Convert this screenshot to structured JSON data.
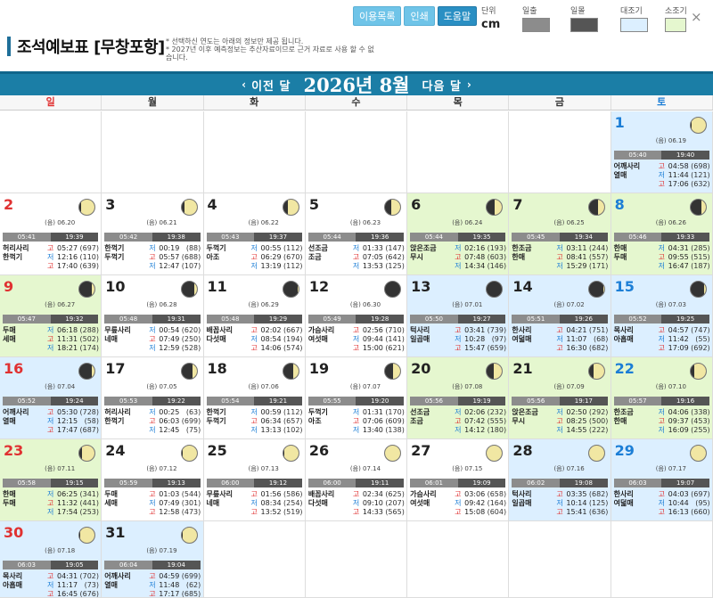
{
  "page": {
    "title": "조석예보표 [무창포항]",
    "notes": [
      "* 선택하신 연도는 아래의 정보만 제공 됩니다.",
      "* 2027년 이후 예측정보는 추산자료이므로 근거 자료로 사용 할 수 없습니다."
    ]
  },
  "toolbar": {
    "buttons": [
      "이용목록",
      "인쇄",
      "도움말"
    ],
    "unit_label": "단위",
    "unit_value": "cm",
    "legend": [
      {
        "label": "일출",
        "color": "#8c8c8c"
      },
      {
        "label": "일몰",
        "color": "#555555"
      },
      {
        "label": "대조기",
        "color": "#dcefff"
      },
      {
        "label": "소조기",
        "color": "#e5f7cf"
      }
    ],
    "close": "×"
  },
  "nav": {
    "prev": "이전 달",
    "next": "다음 달",
    "month": "2026년 8월"
  },
  "weekdays": [
    "일",
    "월",
    "화",
    "수",
    "목",
    "금",
    "토"
  ],
  "colors": {
    "sunday": "#e03131",
    "saturday": "#1c7ed6",
    "header_bar": "#1b7ea6",
    "spring_tide": "#dcefff",
    "neap_tide": "#e5f7cf"
  },
  "days": [
    {
      "d": "1",
      "lunar": "(음) 06.19",
      "sr": "05:40",
      "ss": "19:40",
      "bg": "b",
      "moon": 0.93,
      "mn": [
        "어깨사리",
        "열매"
      ],
      "t": [
        [
          "고",
          "04:58",
          "(698)"
        ],
        [
          "저",
          "11:44",
          "(121)"
        ],
        [
          "고",
          "17:06",
          "(632)"
        ]
      ]
    },
    {
      "d": "2",
      "lunar": "(음) 06.20",
      "sr": "05:41",
      "ss": "19:39",
      "bg": "w",
      "moon": 0.87,
      "mn": [
        "허리사리",
        "한꺽기"
      ],
      "t": [
        [
          "고",
          "05:27",
          "(697)"
        ],
        [
          "저",
          "12:16",
          "(110)"
        ],
        [
          "고",
          "17:40",
          "(639)"
        ]
      ]
    },
    {
      "d": "3",
      "lunar": "(음) 06.21",
      "sr": "05:42",
      "ss": "19:38",
      "bg": "w",
      "moon": 0.8,
      "mn": [
        "한꺽기",
        "두꺽기"
      ],
      "t": [
        [
          "저",
          "00:19",
          "(88)"
        ],
        [
          "고",
          "05:57",
          "(688)"
        ],
        [
          "저",
          "12:47",
          "(107)"
        ]
      ]
    },
    {
      "d": "4",
      "lunar": "(음) 06.22",
      "sr": "05:43",
      "ss": "19:37",
      "bg": "w",
      "moon": 0.7,
      "mn": [
        "두꺽기",
        "아조"
      ],
      "t": [
        [
          "저",
          "00:55",
          "(112)"
        ],
        [
          "고",
          "06:29",
          "(670)"
        ],
        [
          "저",
          "13:19",
          "(112)"
        ]
      ]
    },
    {
      "d": "5",
      "lunar": "(음) 06.23",
      "sr": "05:44",
      "ss": "19:36",
      "bg": "w",
      "moon": 0.6,
      "mn": [
        "선조금",
        "조금"
      ],
      "t": [
        [
          "저",
          "01:33",
          "(147)"
        ],
        [
          "고",
          "07:05",
          "(642)"
        ],
        [
          "저",
          "13:53",
          "(125)"
        ]
      ]
    },
    {
      "d": "6",
      "lunar": "(음) 06.24",
      "sr": "05:44",
      "ss": "19:35",
      "bg": "g",
      "moon": 0.5,
      "mn": [
        "앉은조금",
        "무시"
      ],
      "t": [
        [
          "저",
          "02:16",
          "(193)"
        ],
        [
          "고",
          "07:48",
          "(603)"
        ],
        [
          "저",
          "14:34",
          "(146)"
        ]
      ]
    },
    {
      "d": "7",
      "lunar": "(음) 06.25",
      "sr": "05:45",
      "ss": "19:34",
      "bg": "g",
      "moon": 0.4,
      "mn": [
        "한조금",
        "한매"
      ],
      "t": [
        [
          "저",
          "03:11",
          "(244)"
        ],
        [
          "고",
          "08:41",
          "(557)"
        ],
        [
          "저",
          "15:29",
          "(171)"
        ]
      ]
    },
    {
      "d": "8",
      "lunar": "(음) 06.26",
      "sr": "05:46",
      "ss": "19:33",
      "bg": "g",
      "moon": 0.3,
      "mn": [
        "한매",
        "두매"
      ],
      "t": [
        [
          "저",
          "04:31",
          "(285)"
        ],
        [
          "고",
          "09:55",
          "(515)"
        ],
        [
          "저",
          "16:47",
          "(187)"
        ]
      ]
    },
    {
      "d": "9",
      "lunar": "(음) 06.27",
      "sr": "05:47",
      "ss": "19:32",
      "bg": "g",
      "moon": 0.2,
      "mn": [
        "두매",
        "세매"
      ],
      "t": [
        [
          "저",
          "06:18",
          "(288)"
        ],
        [
          "고",
          "11:31",
          "(502)"
        ],
        [
          "저",
          "18:21",
          "(174)"
        ]
      ]
    },
    {
      "d": "10",
      "lunar": "(음) 06.28",
      "sr": "05:48",
      "ss": "19:31",
      "bg": "w",
      "moon": 0.12,
      "mn": [
        "무릎사리",
        "네매"
      ],
      "t": [
        [
          "저",
          "00:54",
          "(620)"
        ],
        [
          "고",
          "07:49",
          "(250)"
        ],
        [
          "저",
          "12:59",
          "(528)"
        ]
      ]
    },
    {
      "d": "11",
      "lunar": "(음) 06.29",
      "sr": "05:48",
      "ss": "19:29",
      "bg": "w",
      "moon": 0.05,
      "mn": [
        "배꼽사리",
        "다섯매"
      ],
      "t": [
        [
          "고",
          "02:02",
          "(667)"
        ],
        [
          "저",
          "08:54",
          "(194)"
        ],
        [
          "고",
          "14:06",
          "(574)"
        ]
      ]
    },
    {
      "d": "12",
      "lunar": "(음) 06.30",
      "sr": "05:49",
      "ss": "19:28",
      "bg": "w",
      "moon": 0.0,
      "mn": [
        "가슴사리",
        "여섯매"
      ],
      "t": [
        [
          "고",
          "02:56",
          "(710)"
        ],
        [
          "저",
          "09:44",
          "(141)"
        ],
        [
          "고",
          "15:00",
          "(621)"
        ]
      ]
    },
    {
      "d": "13",
      "lunar": "(음) 07.01",
      "sr": "05:50",
      "ss": "19:27",
      "bg": "b",
      "moon": 0.0,
      "mn": [
        "턱사리",
        "일곱매"
      ],
      "t": [
        [
          "고",
          "03:41",
          "(739)"
        ],
        [
          "저",
          "10:28",
          "(97)"
        ],
        [
          "고",
          "15:47",
          "(659)"
        ]
      ]
    },
    {
      "d": "14",
      "lunar": "(음) 07.02",
      "sr": "05:51",
      "ss": "19:26",
      "bg": "b",
      "moon": 0.05,
      "mn": [
        "한사리",
        "여덟매"
      ],
      "t": [
        [
          "고",
          "04:21",
          "(751)"
        ],
        [
          "저",
          "11:07",
          "(68)"
        ],
        [
          "고",
          "16:30",
          "(682)"
        ]
      ]
    },
    {
      "d": "15",
      "lunar": "(음) 07.03",
      "sr": "05:52",
      "ss": "19:25",
      "bg": "b",
      "moon": 0.1,
      "mn": [
        "목사리",
        "아홉매"
      ],
      "t": [
        [
          "고",
          "04:57",
          "(747)"
        ],
        [
          "저",
          "11:42",
          "(55)"
        ],
        [
          "고",
          "17:09",
          "(692)"
        ]
      ]
    },
    {
      "d": "16",
      "lunar": "(음) 07.04",
      "sr": "05:52",
      "ss": "19:24",
      "bg": "b",
      "moon": 0.18,
      "mn": [
        "어깨사리",
        "열매"
      ],
      "t": [
        [
          "고",
          "05:30",
          "(728)"
        ],
        [
          "저",
          "12:15",
          "(58)"
        ],
        [
          "고",
          "17:47",
          "(687)"
        ]
      ]
    },
    {
      "d": "17",
      "lunar": "(음) 07.05",
      "sr": "05:53",
      "ss": "19:22",
      "bg": "w",
      "moon": 0.27,
      "mn": [
        "허리사리",
        "한꺽기"
      ],
      "t": [
        [
          "저",
          "00:25",
          "(63)"
        ],
        [
          "고",
          "06:03",
          "(699)"
        ],
        [
          "저",
          "12:45",
          "(75)"
        ]
      ]
    },
    {
      "d": "18",
      "lunar": "(음) 07.06",
      "sr": "05:54",
      "ss": "19:21",
      "bg": "w",
      "moon": 0.37,
      "mn": [
        "한꺽기",
        "두꺽기"
      ],
      "t": [
        [
          "저",
          "00:59",
          "(112)"
        ],
        [
          "고",
          "06:34",
          "(657)"
        ],
        [
          "저",
          "13:13",
          "(102)"
        ]
      ]
    },
    {
      "d": "19",
      "lunar": "(음) 07.07",
      "sr": "05:55",
      "ss": "19:20",
      "bg": "w",
      "moon": 0.47,
      "mn": [
        "두꺽기",
        "아조"
      ],
      "t": [
        [
          "저",
          "01:31",
          "(170)"
        ],
        [
          "고",
          "07:06",
          "(609)"
        ],
        [
          "저",
          "13:40",
          "(138)"
        ]
      ]
    },
    {
      "d": "20",
      "lunar": "(음) 07.08",
      "sr": "05:56",
      "ss": "19:19",
      "bg": "g",
      "moon": 0.57,
      "mn": [
        "선조금",
        "조금"
      ],
      "t": [
        [
          "저",
          "02:06",
          "(232)"
        ],
        [
          "고",
          "07:42",
          "(555)"
        ],
        [
          "저",
          "14:12",
          "(180)"
        ]
      ]
    },
    {
      "d": "21",
      "lunar": "(음) 07.09",
      "sr": "05:56",
      "ss": "19:17",
      "bg": "g",
      "moon": 0.67,
      "mn": [
        "앉은조금",
        "무시"
      ],
      "t": [
        [
          "저",
          "02:50",
          "(292)"
        ],
        [
          "고",
          "08:25",
          "(500)"
        ],
        [
          "저",
          "14:55",
          "(222)"
        ]
      ]
    },
    {
      "d": "22",
      "lunar": "(음) 07.10",
      "sr": "05:57",
      "ss": "19:16",
      "bg": "g",
      "moon": 0.76,
      "mn": [
        "한조금",
        "한매"
      ],
      "t": [
        [
          "저",
          "04:06",
          "(338)"
        ],
        [
          "고",
          "09:37",
          "(453)"
        ],
        [
          "저",
          "16:09",
          "(255)"
        ]
      ]
    },
    {
      "d": "23",
      "lunar": "(음) 07.11",
      "sr": "05:58",
      "ss": "19:15",
      "bg": "g",
      "moon": 0.84,
      "mn": [
        "한매",
        "두매"
      ],
      "t": [
        [
          "저",
          "06:25",
          "(341)"
        ],
        [
          "고",
          "11:32",
          "(441)"
        ],
        [
          "저",
          "17:54",
          "(253)"
        ]
      ]
    },
    {
      "d": "24",
      "lunar": "(음) 07.12",
      "sr": "05:59",
      "ss": "19:13",
      "bg": "w",
      "moon": 0.9,
      "mn": [
        "두매",
        "세매"
      ],
      "t": [
        [
          "고",
          "01:03",
          "(544)"
        ],
        [
          "저",
          "07:49",
          "(301)"
        ],
        [
          "고",
          "12:58",
          "(473)"
        ]
      ]
    },
    {
      "d": "25",
      "lunar": "(음) 07.13",
      "sr": "06:00",
      "ss": "19:12",
      "bg": "w",
      "moon": 0.95,
      "mn": [
        "무릎사리",
        "네매"
      ],
      "t": [
        [
          "고",
          "01:56",
          "(586)"
        ],
        [
          "저",
          "08:34",
          "(254)"
        ],
        [
          "고",
          "13:52",
          "(519)"
        ]
      ]
    },
    {
      "d": "26",
      "lunar": "(음) 07.14",
      "sr": "06:00",
      "ss": "19:11",
      "bg": "w",
      "moon": 0.98,
      "mn": [
        "배꼽사리",
        "다섯매"
      ],
      "t": [
        [
          "고",
          "02:34",
          "(625)"
        ],
        [
          "저",
          "09:10",
          "(207)"
        ],
        [
          "고",
          "14:33",
          "(565)"
        ]
      ]
    },
    {
      "d": "27",
      "lunar": "(음) 07.15",
      "sr": "06:01",
      "ss": "19:09",
      "bg": "w",
      "moon": 1.0,
      "mn": [
        "가슴사리",
        "여섯매"
      ],
      "t": [
        [
          "고",
          "03:06",
          "(658)"
        ],
        [
          "저",
          "09:42",
          "(164)"
        ],
        [
          "고",
          "15:08",
          "(604)"
        ]
      ]
    },
    {
      "d": "28",
      "lunar": "(음) 07.16",
      "sr": "06:02",
      "ss": "19:08",
      "bg": "b",
      "moon": 1.0,
      "mn": [
        "턱사리",
        "일곱매"
      ],
      "t": [
        [
          "고",
          "03:35",
          "(682)"
        ],
        [
          "저",
          "10:14",
          "(125)"
        ],
        [
          "고",
          "15:41",
          "(636)"
        ]
      ]
    },
    {
      "d": "29",
      "lunar": "(음) 07.17",
      "sr": "06:03",
      "ss": "19:07",
      "bg": "b",
      "moon": 0.98,
      "mn": [
        "한사리",
        "여덟매"
      ],
      "t": [
        [
          "고",
          "04:03",
          "(697)"
        ],
        [
          "저",
          "10:44",
          "(95)"
        ],
        [
          "고",
          "16:13",
          "(660)"
        ]
      ]
    },
    {
      "d": "30",
      "lunar": "(음) 07.18",
      "sr": "06:03",
      "ss": "19:05",
      "bg": "b",
      "moon": 0.95,
      "mn": [
        "목사리",
        "아홉매"
      ],
      "t": [
        [
          "고",
          "04:31",
          "(702)"
        ],
        [
          "저",
          "11:17",
          "(73)"
        ],
        [
          "고",
          "16:45",
          "(676)"
        ]
      ]
    },
    {
      "d": "31",
      "lunar": "(음) 07.19",
      "sr": "06:04",
      "ss": "19:04",
      "bg": "b",
      "moon": 0.9,
      "mn": [
        "어깨사리",
        "열매"
      ],
      "t": [
        [
          "고",
          "04:59",
          "(699)"
        ],
        [
          "저",
          "11:48",
          "(62)"
        ],
        [
          "고",
          "17:17",
          "(685)"
        ]
      ]
    }
  ]
}
